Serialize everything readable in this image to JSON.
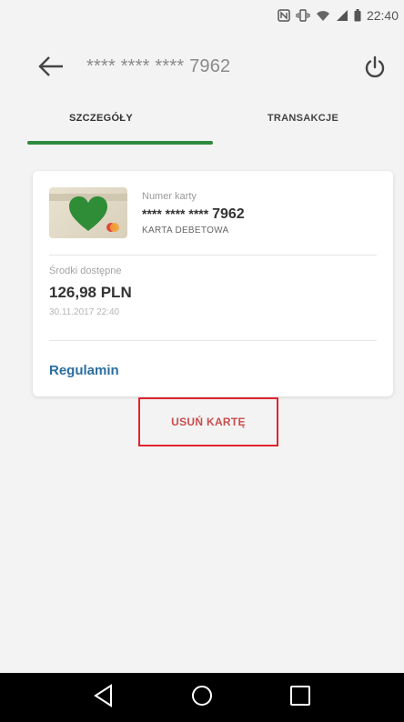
{
  "status_bar": {
    "time": "22:40",
    "icons": [
      "nfc-icon",
      "vibrate-icon",
      "wifi-icon",
      "signal-icon",
      "battery-icon"
    ]
  },
  "header": {
    "title": "**** **** **** 7962",
    "back_icon": "arrow-left-icon",
    "power_icon": "power-icon"
  },
  "tabs": [
    {
      "label": "SZCZEGÓŁY",
      "active": true
    },
    {
      "label": "TRANSAKCJE",
      "active": false
    }
  ],
  "card": {
    "number_label": "Numer karty",
    "number_masked": "**** **** ****",
    "number_last": "7962",
    "type": "KARTA DEBETOWA",
    "balance_label": "Środki dostępne",
    "balance_value": "126,98 PLN",
    "balance_date": "30.11.2017 22:40",
    "regulamin_link": "Regulamin"
  },
  "actions": {
    "remove_label": "USUŃ KARTĘ"
  },
  "colors": {
    "accent_green": "#2e8b3e",
    "link_blue": "#2b6ea0",
    "remove_text": "#c94d4d",
    "highlight_red": "#e0242c"
  }
}
